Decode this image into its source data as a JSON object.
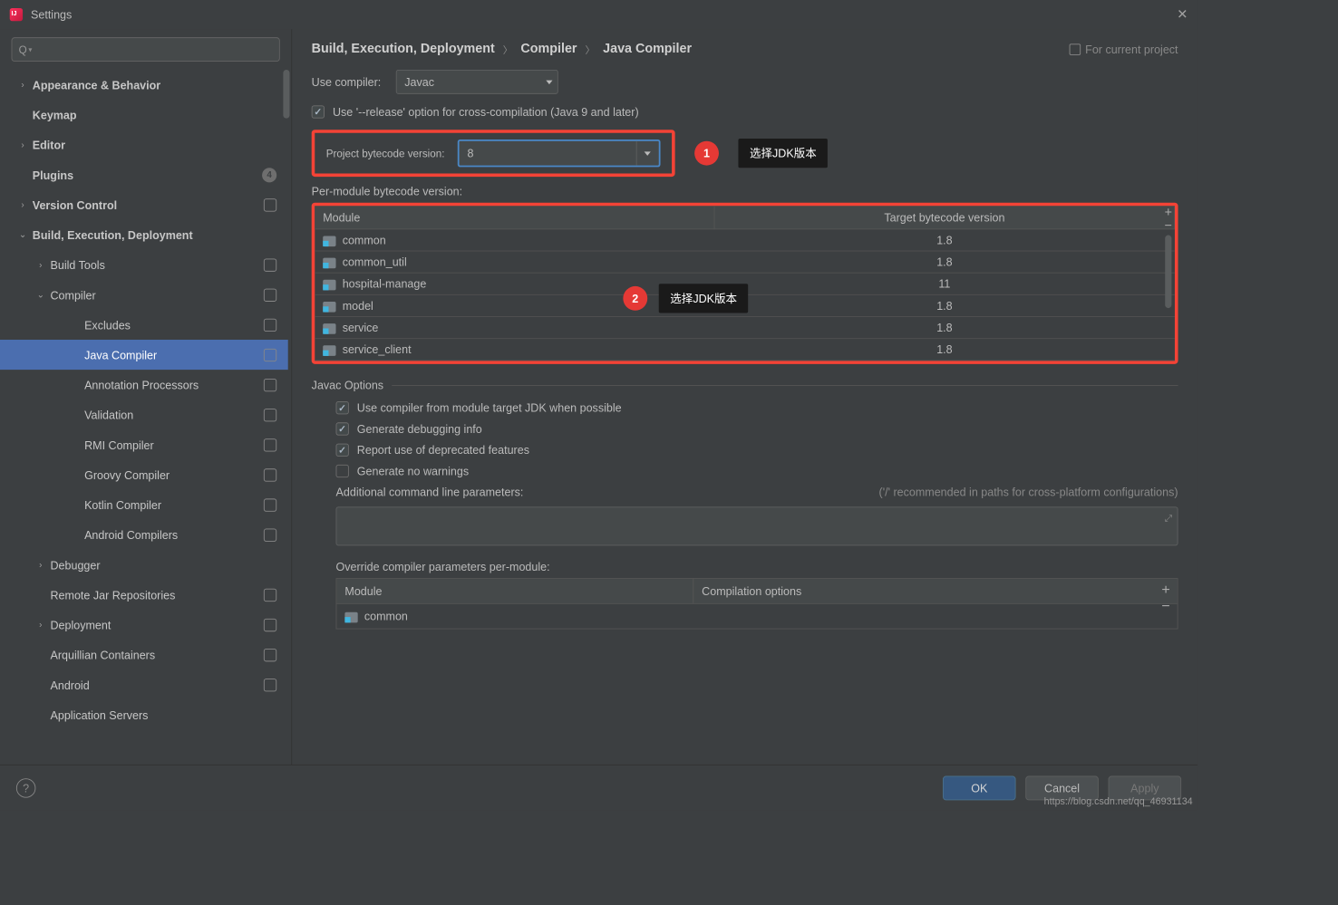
{
  "window": {
    "title": "Settings"
  },
  "sidebar": {
    "search_placeholder": "Q",
    "items": [
      {
        "label": "Appearance & Behavior",
        "bold": true,
        "arrow": "right",
        "level": 1
      },
      {
        "label": "Keymap",
        "bold": true,
        "level": 1
      },
      {
        "label": "Editor",
        "bold": true,
        "arrow": "right",
        "level": 1
      },
      {
        "label": "Plugins",
        "bold": true,
        "level": 1,
        "badge": "4"
      },
      {
        "label": "Version Control",
        "bold": true,
        "arrow": "right",
        "level": 1,
        "scope": true
      },
      {
        "label": "Build, Execution, Deployment",
        "bold": true,
        "arrow": "down",
        "level": 1
      },
      {
        "label": "Build Tools",
        "arrow": "right",
        "level": 2,
        "scope": true
      },
      {
        "label": "Compiler",
        "arrow": "down",
        "level": 2,
        "scope": true
      },
      {
        "label": "Excludes",
        "level": 3,
        "scope": true
      },
      {
        "label": "Java Compiler",
        "level": 3,
        "scope": true,
        "selected": true
      },
      {
        "label": "Annotation Processors",
        "level": 3,
        "scope": true
      },
      {
        "label": "Validation",
        "level": 3,
        "scope": true
      },
      {
        "label": "RMI Compiler",
        "level": 3,
        "scope": true
      },
      {
        "label": "Groovy Compiler",
        "level": 3,
        "scope": true
      },
      {
        "label": "Kotlin Compiler",
        "level": 3,
        "scope": true
      },
      {
        "label": "Android Compilers",
        "level": 3,
        "scope": true
      },
      {
        "label": "Debugger",
        "arrow": "right",
        "level": 2
      },
      {
        "label": "Remote Jar Repositories",
        "level": 2,
        "scope": true
      },
      {
        "label": "Deployment",
        "arrow": "right",
        "level": 2,
        "scope": true
      },
      {
        "label": "Arquillian Containers",
        "level": 2,
        "scope": true
      },
      {
        "label": "Android",
        "level": 2,
        "scope": true
      },
      {
        "label": "Application Servers",
        "level": 2
      }
    ]
  },
  "breadcrumb": [
    "Build, Execution, Deployment",
    "Compiler",
    "Java Compiler"
  ],
  "for_project": "For current project",
  "use_compiler": {
    "label": "Use compiler:",
    "value": "Javac"
  },
  "release_option": "Use '--release' option for cross-compilation (Java 9 and later)",
  "project_bytecode": {
    "label": "Project bytecode version:",
    "value": "8"
  },
  "per_module_label": "Per-module bytecode version:",
  "module_table": {
    "headers": [
      "Module",
      "Target bytecode version"
    ],
    "rows": [
      {
        "module": "common",
        "version": "1.8"
      },
      {
        "module": "common_util",
        "version": "1.8"
      },
      {
        "module": "hospital-manage",
        "version": "11"
      },
      {
        "module": "model",
        "version": "1.8"
      },
      {
        "module": "service",
        "version": "1.8"
      },
      {
        "module": "service_client",
        "version": "1.8"
      }
    ]
  },
  "annotations": {
    "a1": {
      "num": "1",
      "text": "选择JDK版本"
    },
    "a2": {
      "num": "2",
      "text": "选择JDK版本"
    }
  },
  "javac": {
    "title": "Javac Options",
    "opts": [
      {
        "label": "Use compiler from module target JDK when possible",
        "checked": true
      },
      {
        "label": "Generate debugging info",
        "checked": true
      },
      {
        "label": "Report use of deprecated features",
        "checked": true
      },
      {
        "label": "Generate no warnings",
        "checked": false
      }
    ],
    "params_label": "Additional command line parameters:",
    "params_hint": "('/' recommended in paths for cross-platform configurations)",
    "override_label": "Override compiler parameters per-module:",
    "override_headers": [
      "Module",
      "Compilation options"
    ],
    "override_rows": [
      {
        "module": "common"
      }
    ]
  },
  "buttons": {
    "ok": "OK",
    "cancel": "Cancel",
    "apply": "Apply"
  },
  "watermark": "https://blog.csdn.net/qq_46931134"
}
